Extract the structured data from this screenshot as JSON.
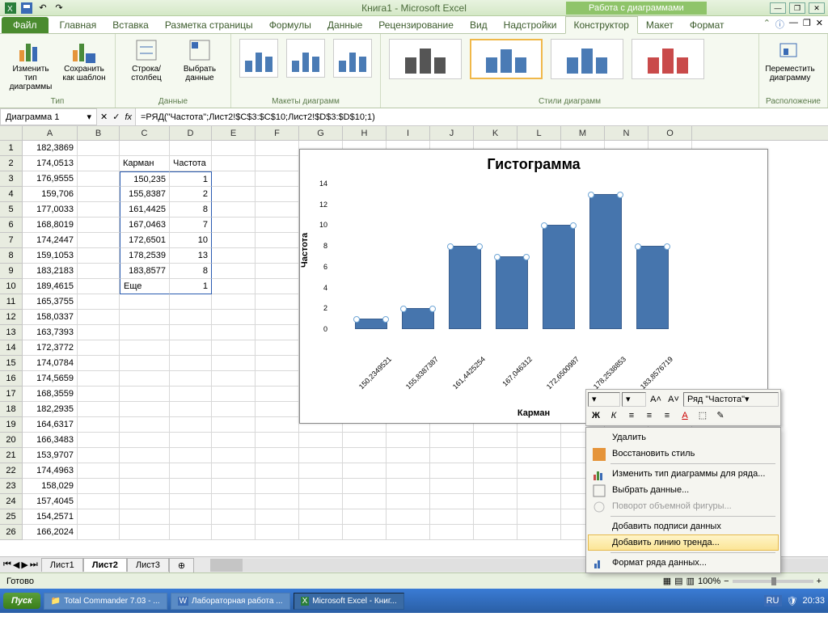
{
  "title": "Книга1  -  Microsoft Excel",
  "chart_tools": "Работа с диаграммами",
  "tabs": [
    "Главная",
    "Вставка",
    "Разметка страницы",
    "Формулы",
    "Данные",
    "Рецензирование",
    "Вид",
    "Надстройки",
    "Конструктор",
    "Макет",
    "Формат"
  ],
  "file_tab": "Файл",
  "ribbon": {
    "g1": "Тип",
    "b1": "Изменить тип\nдиаграммы",
    "b2": "Сохранить\nкак шаблон",
    "g2": "Данные",
    "b3": "Строка/столбец",
    "b4": "Выбрать\nданные",
    "g3": "Макеты диаграмм",
    "g4": "Стили диаграмм",
    "g5": "Расположение",
    "b5": "Переместить\nдиаграмму"
  },
  "name_box": "Диаграмма 1",
  "formula": "=РЯД(\"Частота\";Лист2!$C$3:$C$10;Лист2!$D$3:$D$10;1)",
  "cols": [
    "A",
    "B",
    "C",
    "D",
    "E",
    "F",
    "G",
    "H",
    "I",
    "J",
    "K",
    "L",
    "M",
    "N",
    "O"
  ],
  "col_a": [
    "182,3869",
    "174,0513",
    "176,9555",
    "159,706",
    "177,0033",
    "168,8019",
    "174,2447",
    "159,1053",
    "183,2183",
    "189,4615",
    "165,3755",
    "158,0337",
    "163,7393",
    "172,3772",
    "174,0784",
    "174,5659",
    "168,3559",
    "182,2935",
    "164,6317",
    "166,3483",
    "153,9707",
    "174,4963",
    "158,029",
    "157,4045",
    "154,2571",
    "166,2024"
  ],
  "hdr_c": "Карман",
  "hdr_d": "Частота",
  "col_c": [
    "150,235",
    "155,8387",
    "161,4425",
    "167,0463",
    "172,6501",
    "178,2539",
    "183,8577",
    "Еще"
  ],
  "col_d": [
    "1",
    "2",
    "8",
    "7",
    "10",
    "13",
    "8",
    "1"
  ],
  "chart_data": {
    "type": "bar",
    "title": "Гистограмма",
    "xlabel": "Карман",
    "ylabel": "Частота",
    "ylim": [
      0,
      14
    ],
    "yticks": [
      0,
      2,
      4,
      6,
      8,
      10,
      12,
      14
    ],
    "categories": [
      "150,2349521",
      "155,8387387",
      "161,4425254",
      "167,046312",
      "172,6500987",
      "178,2538853",
      "183,8576719"
    ],
    "values": [
      1,
      2,
      8,
      7,
      10,
      13,
      8
    ]
  },
  "mini_toolbar": {
    "series": "Ряд \"Частота\""
  },
  "ctx": {
    "delete": "Удалить",
    "reset": "Восстановить стиль",
    "change": "Изменить тип диаграммы для ряда...",
    "select": "Выбрать данные...",
    "rotate": "Поворот объемной фигуры...",
    "labels": "Добавить подписи данных",
    "trend": "Добавить линию тренда...",
    "format": "Формат ряда данных..."
  },
  "sheets": [
    "Лист1",
    "Лист2",
    "Лист3"
  ],
  "status": "Готово",
  "zoom": "100%",
  "taskbar": {
    "start": "Пуск",
    "t1": "Total Commander 7.03 - ...",
    "t2": "Лабораторная работа ...",
    "t3": "Microsoft Excel - Книг...",
    "lang": "RU",
    "time": "20:33"
  }
}
